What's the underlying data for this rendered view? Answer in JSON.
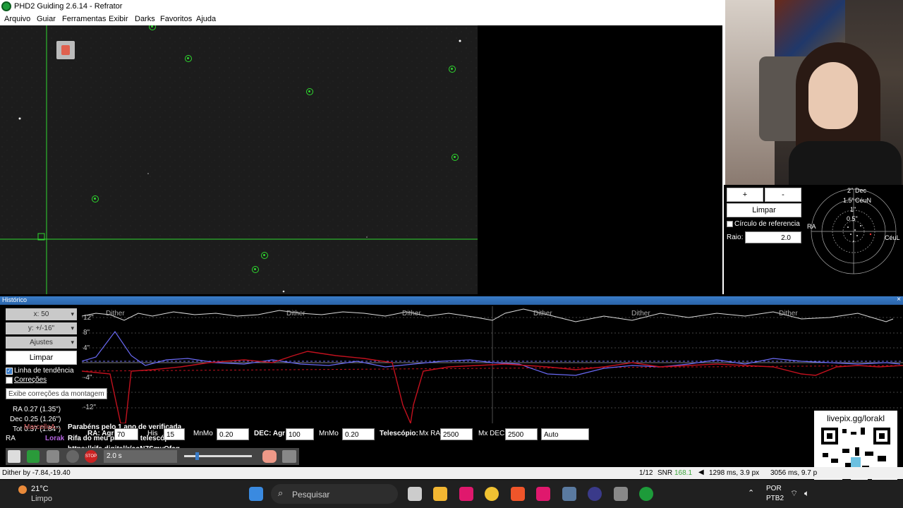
{
  "window": {
    "title": "PHD2 Guiding 2.6.14 - Refrator"
  },
  "menu": [
    "Arquivo",
    "Guiar",
    "Ferramentas",
    "Exibir",
    "Darks",
    "Favoritos",
    "Ajuda"
  ],
  "target_panel": {
    "plus": "+",
    "minus": "-",
    "clear": "Limpar",
    "ref_circle": "Círculo de referencia",
    "radius_label": "Raio:",
    "radius_value": "2.0",
    "labels": {
      "dec": "Dec",
      "ceun_top": "CéuN",
      "ra": "RA",
      "ceul": "CéuL",
      "r2": "2\"",
      "r15": "1.5\"",
      "r1": "1\"",
      "r05": "0.5\""
    }
  },
  "history": {
    "title": "Histórico",
    "x_select": "x: 50",
    "y_select": "y: +/-16\"",
    "adjust": "Ajustes",
    "clear": "Limpar",
    "trend_line": "Linha de tendência",
    "corrections": "Correções",
    "tooltip": "Exibe correções da montagem",
    "rms_label": "RMS (px)",
    "ra_rms": "RA 0.27 (1.35\")",
    "dec_rms": "Dec 0.25 (1.26\")",
    "tot_rms": "Tot 0.37 (1.84\")",
    "ra_prefix": "RA",
    "y_ticks": [
      "12\"",
      "8\"",
      "4\"",
      "-4\"",
      "-12\""
    ],
    "dither_labels": [
      "Dither",
      "Dither",
      "Dither",
      "Dither",
      "Dither",
      "Dither"
    ],
    "ra_agr_label": "RA: Agr",
    "ra_agr": "70",
    "his_label": "His",
    "his": "15",
    "mnmo_label": "MnMo",
    "mnmo_ra": "0.20",
    "dec_agr_label": "DEC: Agr",
    "dec_agr": "100",
    "mnmo_dec": "0.20",
    "telescope_label": "Telescópio:",
    "mx_ra_label": "Mx RA",
    "mx_ra": "2500",
    "mx_dec_label": "Mx DEC",
    "mx_dec": "2500",
    "auto": "Auto"
  },
  "chat": {
    "user1": "MarcelloA...",
    "msg1": "Parabéns pelo 1 ano de verificada",
    "user2": "Lorak",
    "msg2": "Rifa do meu primeiro telescópio:",
    "msg3": "https://rifa.digital/r/coN7SmyQfcg"
  },
  "toolbar": {
    "exposure": "2.0 s"
  },
  "status": {
    "left": "Dither by -7.84,-19.40",
    "frames": "1/12",
    "snr_label": "SNR",
    "snr": "168.1",
    "pulse": "1298 ms, 3.9 px",
    "pulse2": "3056 ms, 9.7 p"
  },
  "qr_text": "livepix.gg/lorakl",
  "taskbar": {
    "temp": "21°C",
    "weather": "Limpo",
    "search": "Pesquisar",
    "lang1": "POR",
    "lang2": "PTB2"
  },
  "colors": {
    "ra": "#c2111e",
    "dec": "#6a6af5",
    "snr": "#3da63d",
    "titlebar": "#2a64a8"
  }
}
